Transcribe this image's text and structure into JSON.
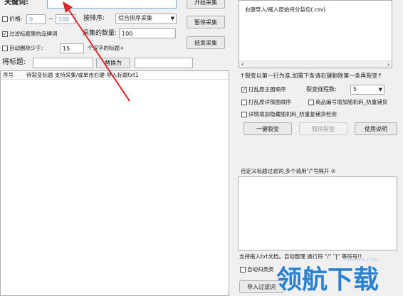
{
  "left": {
    "keyword_label": "关键词:",
    "keyword_value": "",
    "start_button": "开始采集",
    "price_label": "价格:",
    "price_min": "0",
    "price_sep": "~",
    "price_max": "100",
    "sort_label": "按排序:",
    "sort_value": "综合排序采集",
    "pause_button": "暂停采集",
    "filter_brand_label": "过滤标题里的品牌词",
    "collect_count_label": "采集的数量:",
    "collect_count_value": "100",
    "auto_delete_label": "自动删除少于:",
    "auto_delete_value": "15",
    "auto_delete_suffix": "个汉字的标题+",
    "end_button": "结束采集",
    "title_label": "将标题:",
    "title_from_value": "",
    "replace_button": "替换为",
    "title_to_value": "",
    "table_headers": [
      "序号",
      "待裂变标题 支持采集/或单击右键-导入标题txt1"
    ]
  },
  "right": {
    "import_csv_text": "右键导入/拖入原始待分裂包(.csv)",
    "split_note": "↑裂变以第一行为准,加需下条请右键删除第一条再裂变↑",
    "checkbox_shuffle_main": "打乱原主图顺序",
    "split_threads_label": "裂变线程数:",
    "split_threads_value": "5",
    "checkbox_shuffle_detail": "打乱原详情图顺序",
    "checkbox_product_code": "商品编号增加随机码_防重铺货",
    "checkbox_detail_random": "详情增加隐藏随机码_防重复铺货检测",
    "one_key_split_button": "一键裂变",
    "pause_split_button": "暂停裂变",
    "help_button": "使用说明",
    "custom_filter_label": "自定义标题过滤词,多个请用\"/\"号隔开 ②",
    "support_note": "支持拖入txt文档。自动整理 换行符 \"/\" \"|\" 等符号!!",
    "auto_classify_label": "自动归类类",
    "import_filter_button": "导入过滤词"
  },
  "watermark": {
    "brand_text": "领航下载",
    "site_text": "lhdown.com"
  },
  "annotation": {
    "arrow_color": "#d9262c"
  }
}
